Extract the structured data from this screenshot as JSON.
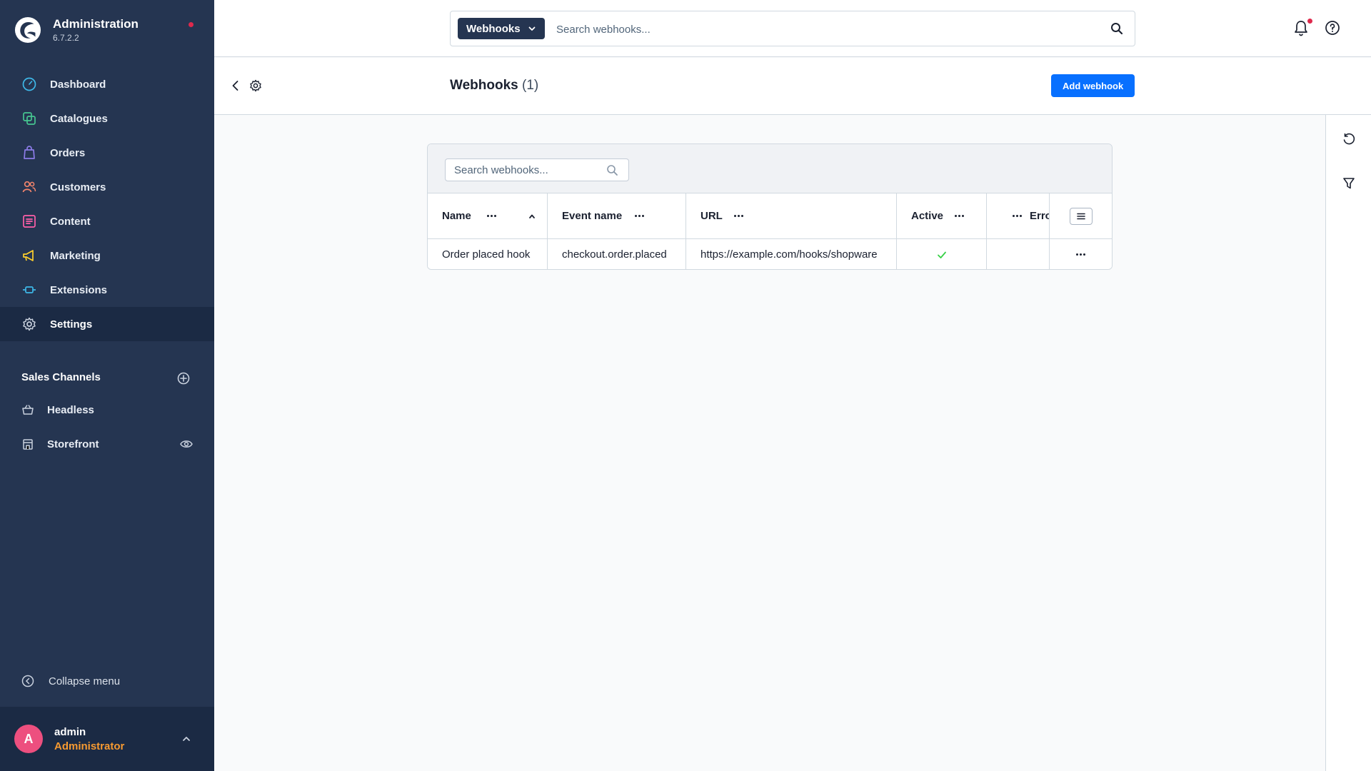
{
  "app": {
    "title": "Administration",
    "version": "6.7.2.2"
  },
  "sidebar": {
    "items": [
      {
        "label": "Dashboard",
        "icon": "dashboard-icon"
      },
      {
        "label": "Catalogues",
        "icon": "catalogue-icon"
      },
      {
        "label": "Orders",
        "icon": "shopping-bag-icon"
      },
      {
        "label": "Customers",
        "icon": "users-icon"
      },
      {
        "label": "Content",
        "icon": "content-icon"
      },
      {
        "label": "Marketing",
        "icon": "megaphone-icon"
      },
      {
        "label": "Extensions",
        "icon": "plug-icon"
      },
      {
        "label": "Settings",
        "icon": "gear-icon",
        "active": true
      }
    ],
    "sales_channels_title": "Sales Channels",
    "sales_channels": [
      {
        "label": "Headless",
        "icon": "basket-icon"
      },
      {
        "label": "Storefront",
        "icon": "storefront-icon"
      }
    ],
    "collapse_label": "Collapse menu",
    "user": {
      "initial": "A",
      "name": "admin",
      "role": "Administrator"
    }
  },
  "header": {
    "search_type": "Webhooks",
    "search_placeholder": "Search webhooks..."
  },
  "page": {
    "title": "Webhooks",
    "count": "(1)",
    "add_button": "Add webhook"
  },
  "grid": {
    "search_placeholder": "Search webhooks...",
    "columns": [
      "Name",
      "Event name",
      "URL",
      "Active",
      "Erro"
    ],
    "rows": [
      {
        "name": "Order placed hook",
        "event": "checkout.order.placed",
        "url": "https://example.com/hooks/shopware",
        "active": true
      }
    ]
  },
  "colors": {
    "sidebar": "#253551",
    "sidebar_active": "#1b2a44",
    "primary": "#0870ff",
    "notification": "#de294c",
    "avatar": "#ed4f7f",
    "role": "#f79a31",
    "success": "#37d046"
  }
}
